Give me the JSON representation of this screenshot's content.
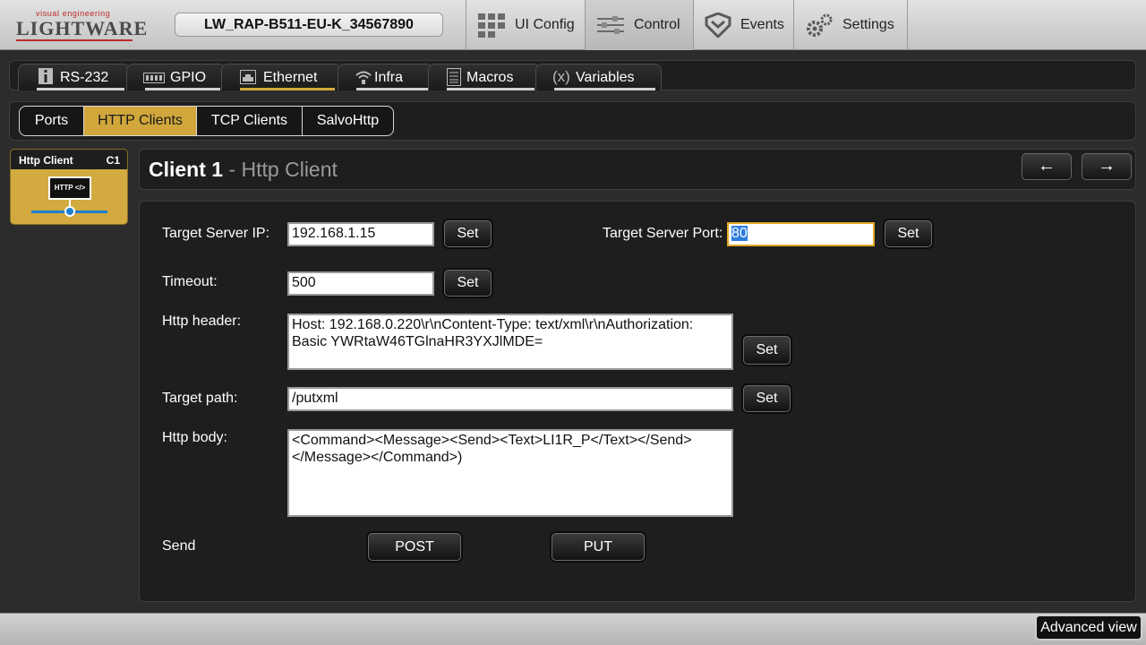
{
  "header": {
    "logo_tagline": "visual engineering",
    "logo_word": "LIGHTWARE",
    "device_name": "LW_RAP-B511-EU-K_34567890",
    "nav": [
      {
        "label": "UI Config",
        "icon": "grid-icon"
      },
      {
        "label": "Control",
        "icon": "sliders-icon"
      },
      {
        "label": "Events",
        "icon": "events-icon"
      },
      {
        "label": "Settings",
        "icon": "gears-icon"
      }
    ],
    "active_nav": "Control"
  },
  "subtabs": [
    {
      "label": "RS-232",
      "icon": "info-icon"
    },
    {
      "label": "GPIO",
      "icon": "gpio-icon"
    },
    {
      "label": "Ethernet",
      "icon": "ethernet-icon"
    },
    {
      "label": "Infra",
      "icon": "infra-icon"
    },
    {
      "label": "Macros",
      "icon": "macros-icon"
    },
    {
      "label": "Variables",
      "icon": "variables-icon"
    }
  ],
  "active_subtab": "Ethernet",
  "tabs3": [
    "Ports",
    "HTTP Clients",
    "TCP Clients",
    "SalvoHttp"
  ],
  "active_tab3": "HTTP Clients",
  "tile": {
    "name": "Http Client",
    "code": "C1",
    "icon_text": "HTTP </>"
  },
  "panel_title": {
    "main": "Client 1",
    "separator": " - ",
    "sub": "Http Client"
  },
  "nav_arrows": {
    "prev": "←",
    "next": "→"
  },
  "form": {
    "target_ip_label": "Target Server IP:",
    "target_ip_value": "192.168.1.15",
    "target_port_label": "Target Server Port:",
    "target_port_value": "80",
    "timeout_label": "Timeout:",
    "timeout_value": "500",
    "header_label": "Http header:",
    "header_value": "Host: 192.168.0.220\\r\\nContent-Type: text/xml\\r\\nAuthorization: Basic YWRtaW46TGlnaHR3YXJlMDE=",
    "path_label": "Target path:",
    "path_value": "/putxml",
    "body_label": "Http body:",
    "body_value": "<Command><Message><Send><Text>LI1R_P</Text></Send></Message></Command>)",
    "set_label": "Set",
    "send_label": "Send",
    "post_label": "POST",
    "put_label": "PUT"
  },
  "footer": {
    "advanced_view": "Advanced view"
  },
  "colors": {
    "accent": "#d1a73b",
    "focus": "#e0a825",
    "line_blue": "#1e7fd1",
    "brand_red": "#c02a2a"
  }
}
